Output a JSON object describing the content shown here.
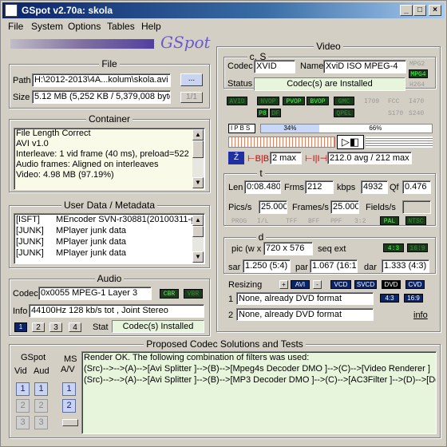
{
  "window": {
    "title": "GSpot v2.70a: skola"
  },
  "menu": [
    "File",
    "System",
    "Options",
    "Tables",
    "Help"
  ],
  "logo_text": "GSpot",
  "file": {
    "title": "File",
    "path_label": "Path",
    "path": "H:\\2012-2013\\4A...kolum\\skola.avi",
    "browse": "...",
    "size_label": "Size",
    "size": "5.12 MB (5,252 KB / 5,379,008 byte",
    "page": "1/1"
  },
  "container": {
    "title": "Container",
    "lines": [
      "File Length Correct",
      "AVI v1.0",
      "Interleave: 1 vid frame (40 ms), preload=522",
      "Audio frames: Aligned on interleaves",
      "Video: 4.98 MB (97.19%)"
    ]
  },
  "userdata": {
    "title": "User Data / Metadata",
    "rows": [
      [
        "[ISFT]",
        "MEncoder SVN-r30881(20100311-g"
      ],
      [
        "[JUNK]",
        "MPlayer junk data"
      ],
      [
        "[JUNK]",
        "MPlayer junk data"
      ],
      [
        "[JUNK]",
        "MPlayer junk data"
      ]
    ]
  },
  "audio": {
    "title": "Audio",
    "codec_label": "Codec",
    "codec": "0x0055 MPEG-1 Layer 3",
    "cbr": "CBR",
    "vbr": "VBR",
    "info_label": "Info",
    "info": "44100Hz  128 kb/s tot , Joint Stereo",
    "tabs": [
      "1",
      "2",
      "3",
      "4"
    ],
    "stat_label": "Stat",
    "stat": "Codec(s) Installed"
  },
  "proposed": {
    "title": "Proposed Codec Solutions and Tests",
    "gspot": "GSpot",
    "ms": "MS",
    "vid": "Vid",
    "aud": "Aud",
    "av": "A/V",
    "lines": [
      "Render OK. The following combination of filters was used:",
      "(Src)-->-->(A)-->[Avi Splitter ]-->(B)-->[Mpeg4s Decoder DMO ]-->(C)-->[Video Renderer ]",
      "(Src)-->-->(A)-->[Avi Splitter ]-->(B)-->[MP3 Decoder DMO ]-->(C)-->[AC3Filter ]-->(D)-->[Default I"
    ]
  },
  "video": {
    "title": "Video",
    "cs": "c, S",
    "codec_label": "Codec",
    "codec": "XVID",
    "name_label": "Name",
    "name": "XviD ISO MPEG-4",
    "status_label": "Status",
    "status": "Codec(s) are Installed",
    "side_tags": [
      "MPG2",
      "MPG4",
      "H264"
    ],
    "tags_row1": [
      "AVID",
      "NVOP",
      "PVOP",
      "BVOP",
      "GMC",
      "I709",
      "FCC",
      "I470"
    ],
    "tags_row2": [
      "P8",
      "DF",
      "QPEL",
      "S170",
      "S240"
    ],
    "frame_types": "IPBS",
    "pct1": "34%",
    "pct2": "66%",
    "bmax": "2 max",
    "bitrate": "212.0 avg / 212 max",
    "t": "t",
    "len_label": "Len",
    "len": "0:08.480",
    "frms_label": "Frms",
    "frms": "212",
    "kbps_label": "kbps",
    "kbps": "4932",
    "qf_label": "Qf",
    "qf": "0.476",
    "pics_label": "Pics/s",
    "pics": "25.000",
    "frames_label": "Frames/s",
    "frames": "25.000",
    "fields_label": "Fields/s",
    "fields": "",
    "flags": [
      "PROG",
      "I/L",
      "TFF",
      "BFF",
      "PPF",
      "3:2",
      "PAL",
      "NTSC"
    ],
    "d": "d",
    "pic_label": "pic (w x",
    "pic": "720 x 576",
    "seqext": "seq ext",
    "ar1": "4:3",
    "ar2": "16:9",
    "sar_label": "sar",
    "sar": "1.250 (5:4)",
    "par_label": "par",
    "par": "1.067 (16:15",
    "dar_label": "dar",
    "dar": "1.333 (4:3)",
    "resizing": "Resizing",
    "rs_btns": [
      "+",
      "AVI",
      "-",
      "VCD",
      "SVCD",
      "DVD",
      "CVD"
    ],
    "r1": "1",
    "r1v": "None, already DVD format",
    "r2": "2",
    "r2v": "None, already DVD format",
    "ra1": "4:3",
    "ra2": "16:9",
    "info": "info"
  }
}
